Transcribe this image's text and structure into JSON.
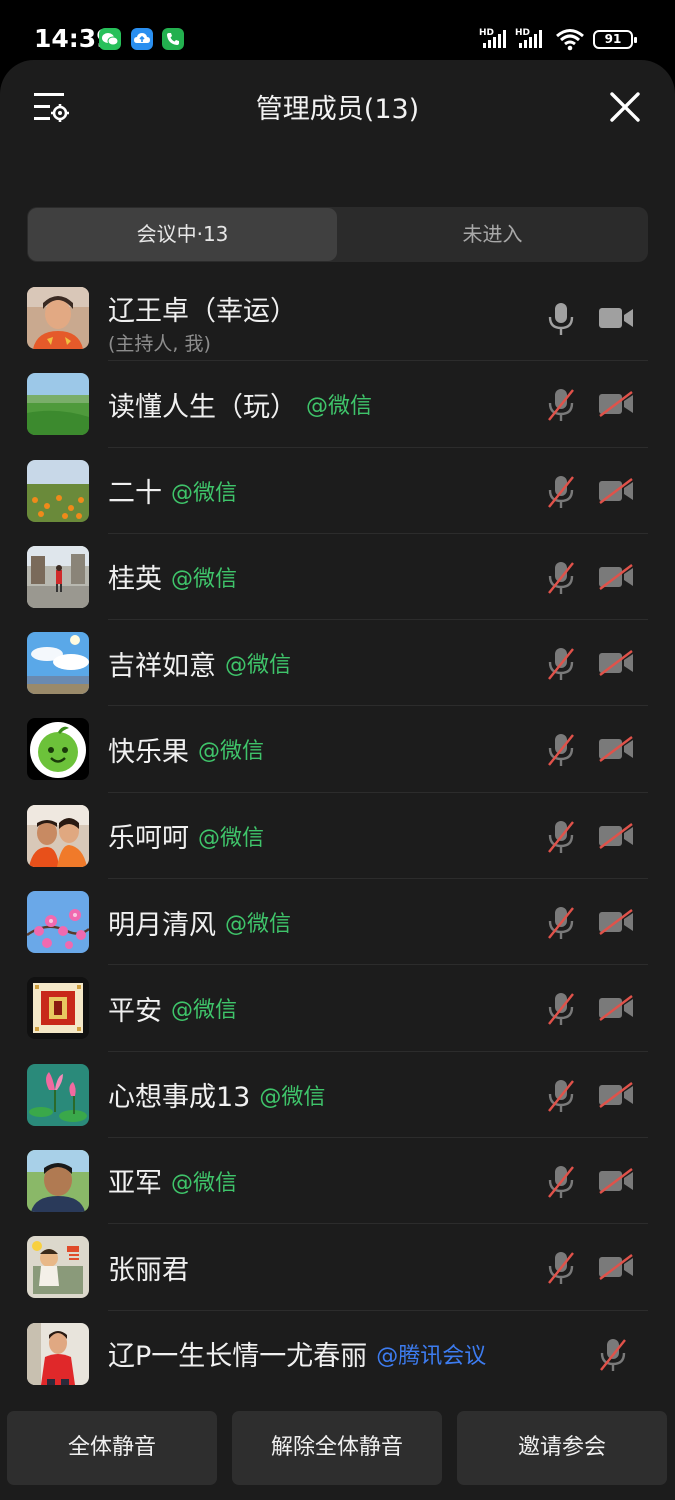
{
  "status_bar": {
    "time": "14:39",
    "battery": "91",
    "notification_icons": [
      "wechat-icon",
      "cloud-upload-icon",
      "phone-icon"
    ],
    "signal_labels": [
      "HD",
      "HD"
    ]
  },
  "header": {
    "title": "管理成员(13)"
  },
  "tabs": [
    {
      "label": "会议中·13",
      "active": true
    },
    {
      "label": "未进入",
      "active": false
    }
  ],
  "members": [
    {
      "name": "辽王卓（幸运）",
      "subtitle": "(主持人, 我)",
      "source": "",
      "mic": "on",
      "camera": "off-gray"
    },
    {
      "name": "读懂人生（玩）",
      "source": "@微信",
      "mic": "muted",
      "camera": "off"
    },
    {
      "name": "二十",
      "source": "@微信",
      "mic": "muted",
      "camera": "off"
    },
    {
      "name": "桂英",
      "source": "@微信",
      "mic": "muted",
      "camera": "off"
    },
    {
      "name": "吉祥如意",
      "source": "@微信",
      "mic": "muted",
      "camera": "off"
    },
    {
      "name": "快乐果",
      "source": "@微信",
      "mic": "muted",
      "camera": "off"
    },
    {
      "name": "乐呵呵",
      "source": "@微信",
      "mic": "muted",
      "camera": "off"
    },
    {
      "name": "明月清风",
      "source": "@微信",
      "mic": "muted",
      "camera": "off"
    },
    {
      "name": "平安",
      "source": "@微信",
      "mic": "muted",
      "camera": "off"
    },
    {
      "name": "心想事成13",
      "source": "@微信",
      "mic": "muted",
      "camera": "off"
    },
    {
      "name": "亚军",
      "source": "@微信",
      "mic": "muted",
      "camera": "off"
    },
    {
      "name": "张丽君",
      "source": "",
      "mic": "muted",
      "camera": "off"
    },
    {
      "name": "辽P一生长情一尤春丽",
      "source": "@腾讯会议",
      "mic": "muted",
      "camera": "none"
    }
  ],
  "bottom_buttons": {
    "mute_all": "全体静音",
    "unmute_all": "解除全体静音",
    "invite": "邀请参会"
  },
  "colors": {
    "panel_bg": "#1c1c1c",
    "wechat_green": "#3fc46a",
    "tencent_blue": "#3d7cf0",
    "muted_red": "#e0524a"
  }
}
